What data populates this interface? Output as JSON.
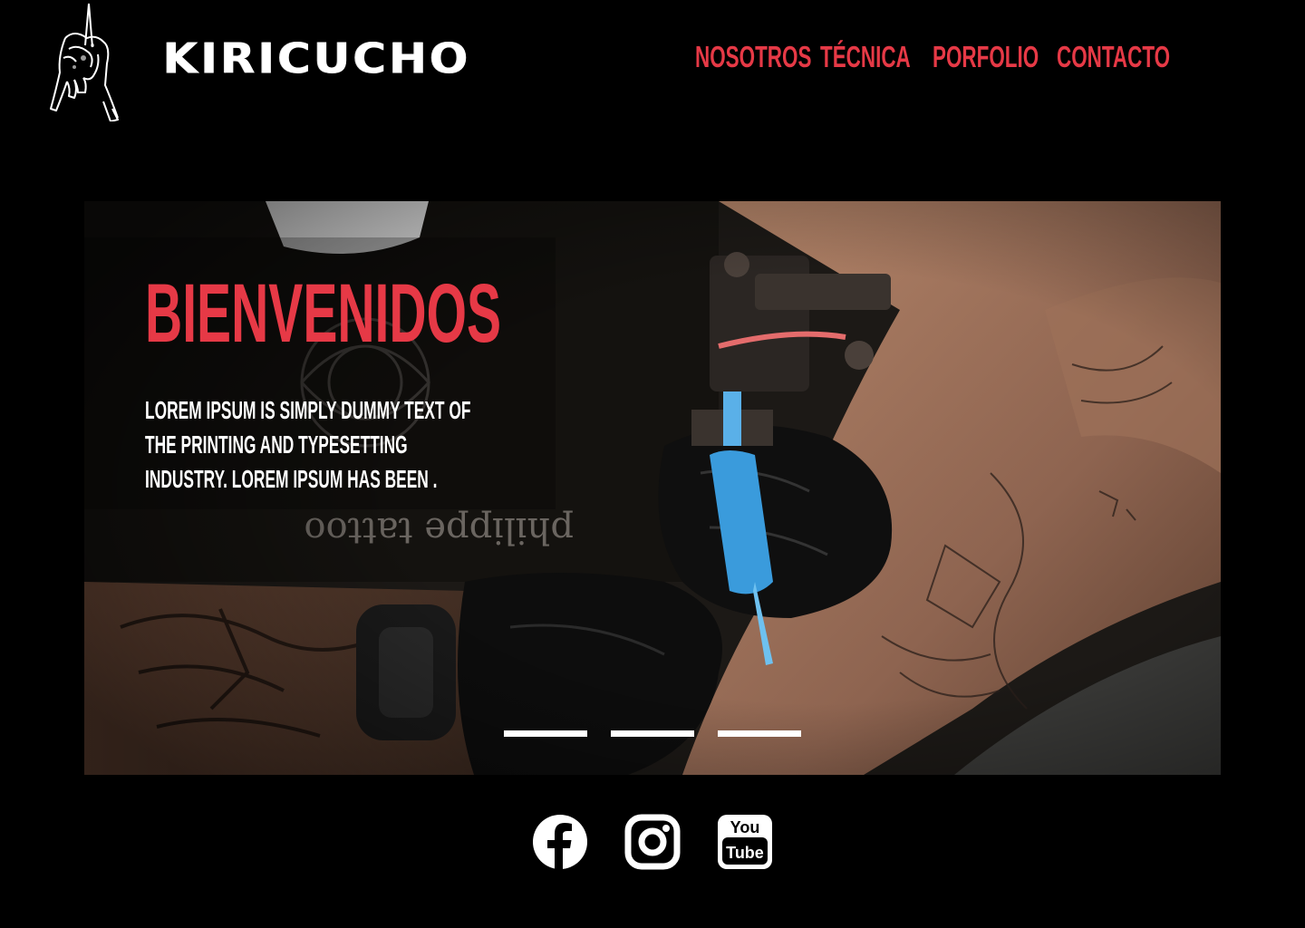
{
  "brand": {
    "name": "KIRICUCHO"
  },
  "nav": {
    "items": [
      "NOSOTROS",
      "TÉCNICA",
      "PORFOLIO",
      "CONTACTO"
    ]
  },
  "hero": {
    "title": "BIENVENIDOS",
    "text": "LOREM IPSUM IS SIMPLY DUMMY TEXT OF THE PRINTING AND TYPESETTING INDUSTRY. LOREM IPSUM HAS BEEN .",
    "slides": 3
  },
  "social": {
    "icons": [
      "facebook-icon",
      "instagram-icon",
      "youtube-icon"
    ],
    "youtube_you": "You",
    "youtube_tube": "Tube"
  },
  "colors": {
    "accent": "#e63946",
    "background": "#000000",
    "text": "#ffffff"
  }
}
